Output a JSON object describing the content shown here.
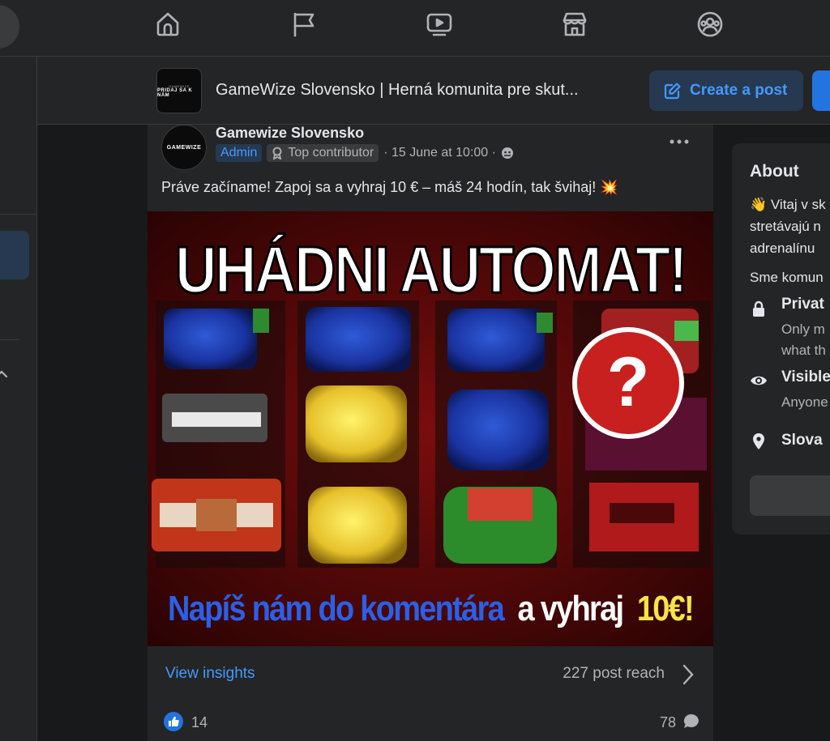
{
  "nav": {
    "icons": [
      "home-icon",
      "flag-icon",
      "video-icon",
      "marketplace-icon",
      "groups-icon"
    ]
  },
  "group": {
    "title": "GameWize Slovensko | Herná komunita pre skut...",
    "avatar_line1": "GAMEWIZE",
    "avatar_line2": "PRIDAJ SA K NÁM",
    "create_post_label": "Create a post"
  },
  "post": {
    "author": "Gamewize Slovensko",
    "author_avatar_text": "GAMEWIZE",
    "badge_admin": "Admin",
    "badge_top": "Top contributor",
    "timestamp": "· 15 June at 10:00 ·",
    "text": "Práve začíname! Zapoj sa a vyhraj 10 € – máš 24 hodín, tak švihaj! 💥",
    "image": {
      "headline": "UHÁDNI AUTOMAT!",
      "question_mark": "?",
      "caption_blue": "Napíš nám do komentára",
      "caption_white": "a vyhraj",
      "caption_yellow": "10€!"
    },
    "view_insights": "View insights",
    "reach": "227 post reach",
    "likes": "14",
    "comments": "78"
  },
  "about": {
    "title": "About",
    "line1": "👋 Vitaj v sk",
    "line2": "stretávajú n",
    "line3": "adrenalínu",
    "line4": "Sme komun",
    "private_title": "Privat",
    "private_sub1": "Only m",
    "private_sub2": "what th",
    "visible_title": "Visible",
    "visible_sub": "Anyone",
    "location": "Slova"
  },
  "colors": {
    "background": "#18191a",
    "card": "#242526",
    "accent": "#4599ff",
    "accent_bg": "#263951",
    "primary_button": "#2374e1",
    "caption_blue": "#2b5fe6",
    "caption_yellow": "#f5e44a"
  }
}
